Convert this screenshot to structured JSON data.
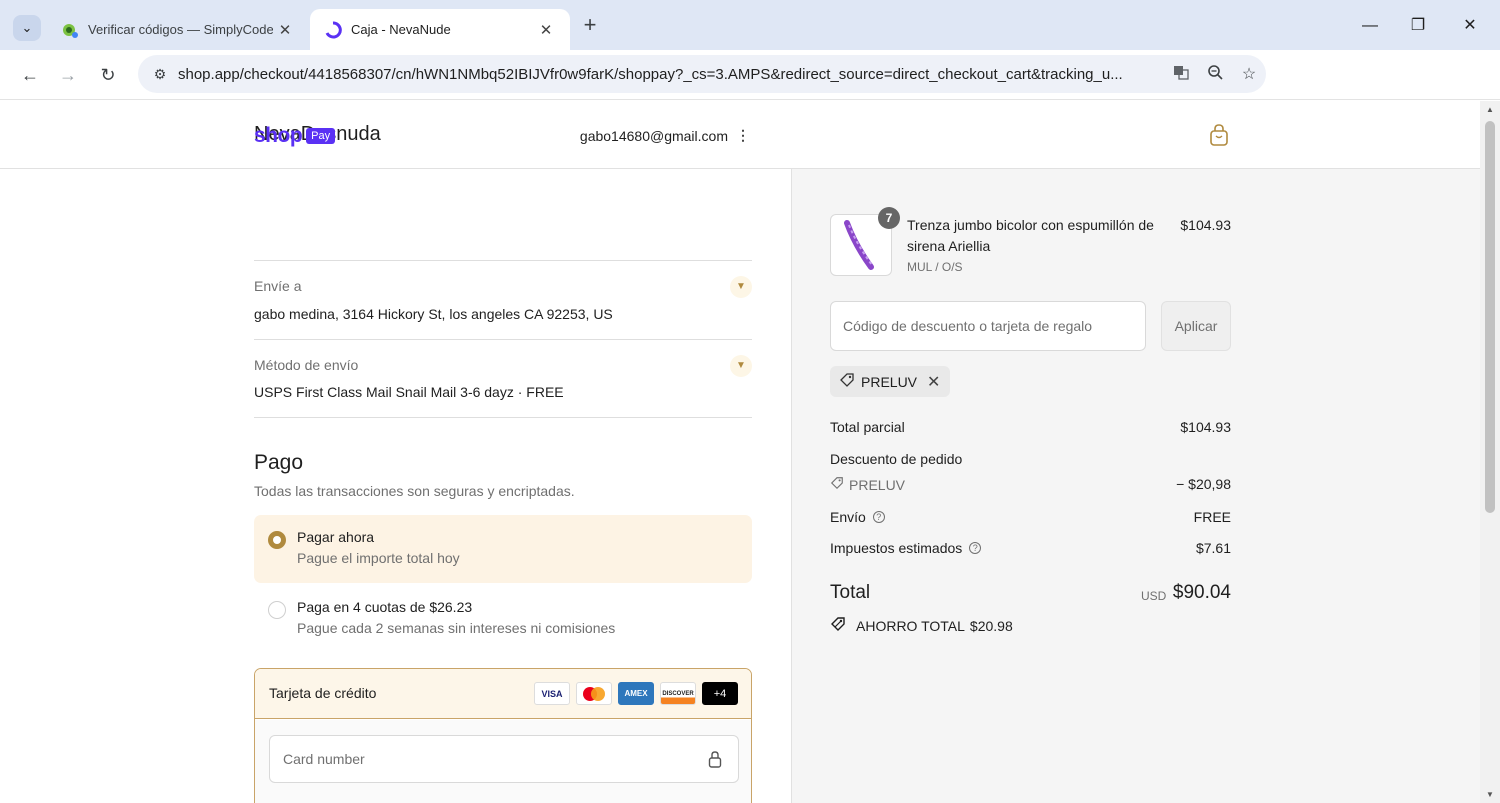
{
  "browser": {
    "tabs": [
      {
        "title": "Verificar códigos — SimplyCodes",
        "active": false
      },
      {
        "title": "Caja - NevaNude",
        "active": true
      }
    ],
    "url": "shop.app/checkout/4418568307/cn/hWN1NMbq52IBIJVfr0w9farK/shoppay?_cs=3.AMPS&redirect_source=direct_checkout_cart&tracking_u...",
    "profile_initial": "G"
  },
  "header": {
    "store_name": "NevaDesnuda"
  },
  "shoppay": {
    "logo_word": "shop",
    "logo_badge": "Pay",
    "email": "gabo14680@gmail.com"
  },
  "shipping": {
    "ship_to_label": "Envíe a",
    "ship_to_value": "gabo medina, 3164 Hickory St, los angeles CA 92253, US",
    "method_label": "Método de envío",
    "method_value": "USPS First Class Mail Snail Mail 3-6 dayz · FREE"
  },
  "payment": {
    "title": "Pago",
    "subtitle": "Todas las transacciones son seguras y encriptadas.",
    "options": [
      {
        "title": "Pagar ahora",
        "desc": "Pague el importe total hoy",
        "selected": true
      },
      {
        "title": "Paga en 4 cuotas de $26.23",
        "desc": "Pague cada 2 semanas sin intereses ni comisiones",
        "selected": false
      }
    ],
    "card_label": "Tarjeta de crédito",
    "card_logos": [
      "VISA",
      "mastercard",
      "AMEX",
      "DISCOVER",
      "+4"
    ],
    "card_number_placeholder": "Card number"
  },
  "order": {
    "item": {
      "qty": "7",
      "name": "Trenza jumbo bicolor con espumillón de sirena Ariellia",
      "variant": "MUL / O/S",
      "price": "$104.93"
    },
    "discount_placeholder": "Código de descuento o tarjeta de regalo",
    "apply_label": "Aplicar",
    "applied_code": "PRELUV",
    "subtotal_label": "Total parcial",
    "subtotal_value": "$104.93",
    "discount_label": "Descuento de pedido",
    "discount_code": "PRELUV",
    "discount_value": "− $20,98",
    "shipping_label": "Envío",
    "shipping_value": "FREE",
    "tax_label": "Impuestos estimados",
    "tax_value": "$7.61",
    "total_label": "Total",
    "currency": "USD",
    "total_value": "$90.04",
    "savings_label": "AHORRO TOTAL",
    "savings_value": "$20.98"
  },
  "colors": {
    "accent": "#b08a3e",
    "shoppay": "#5a31f4",
    "selected_bg": "#fdf3e4"
  }
}
